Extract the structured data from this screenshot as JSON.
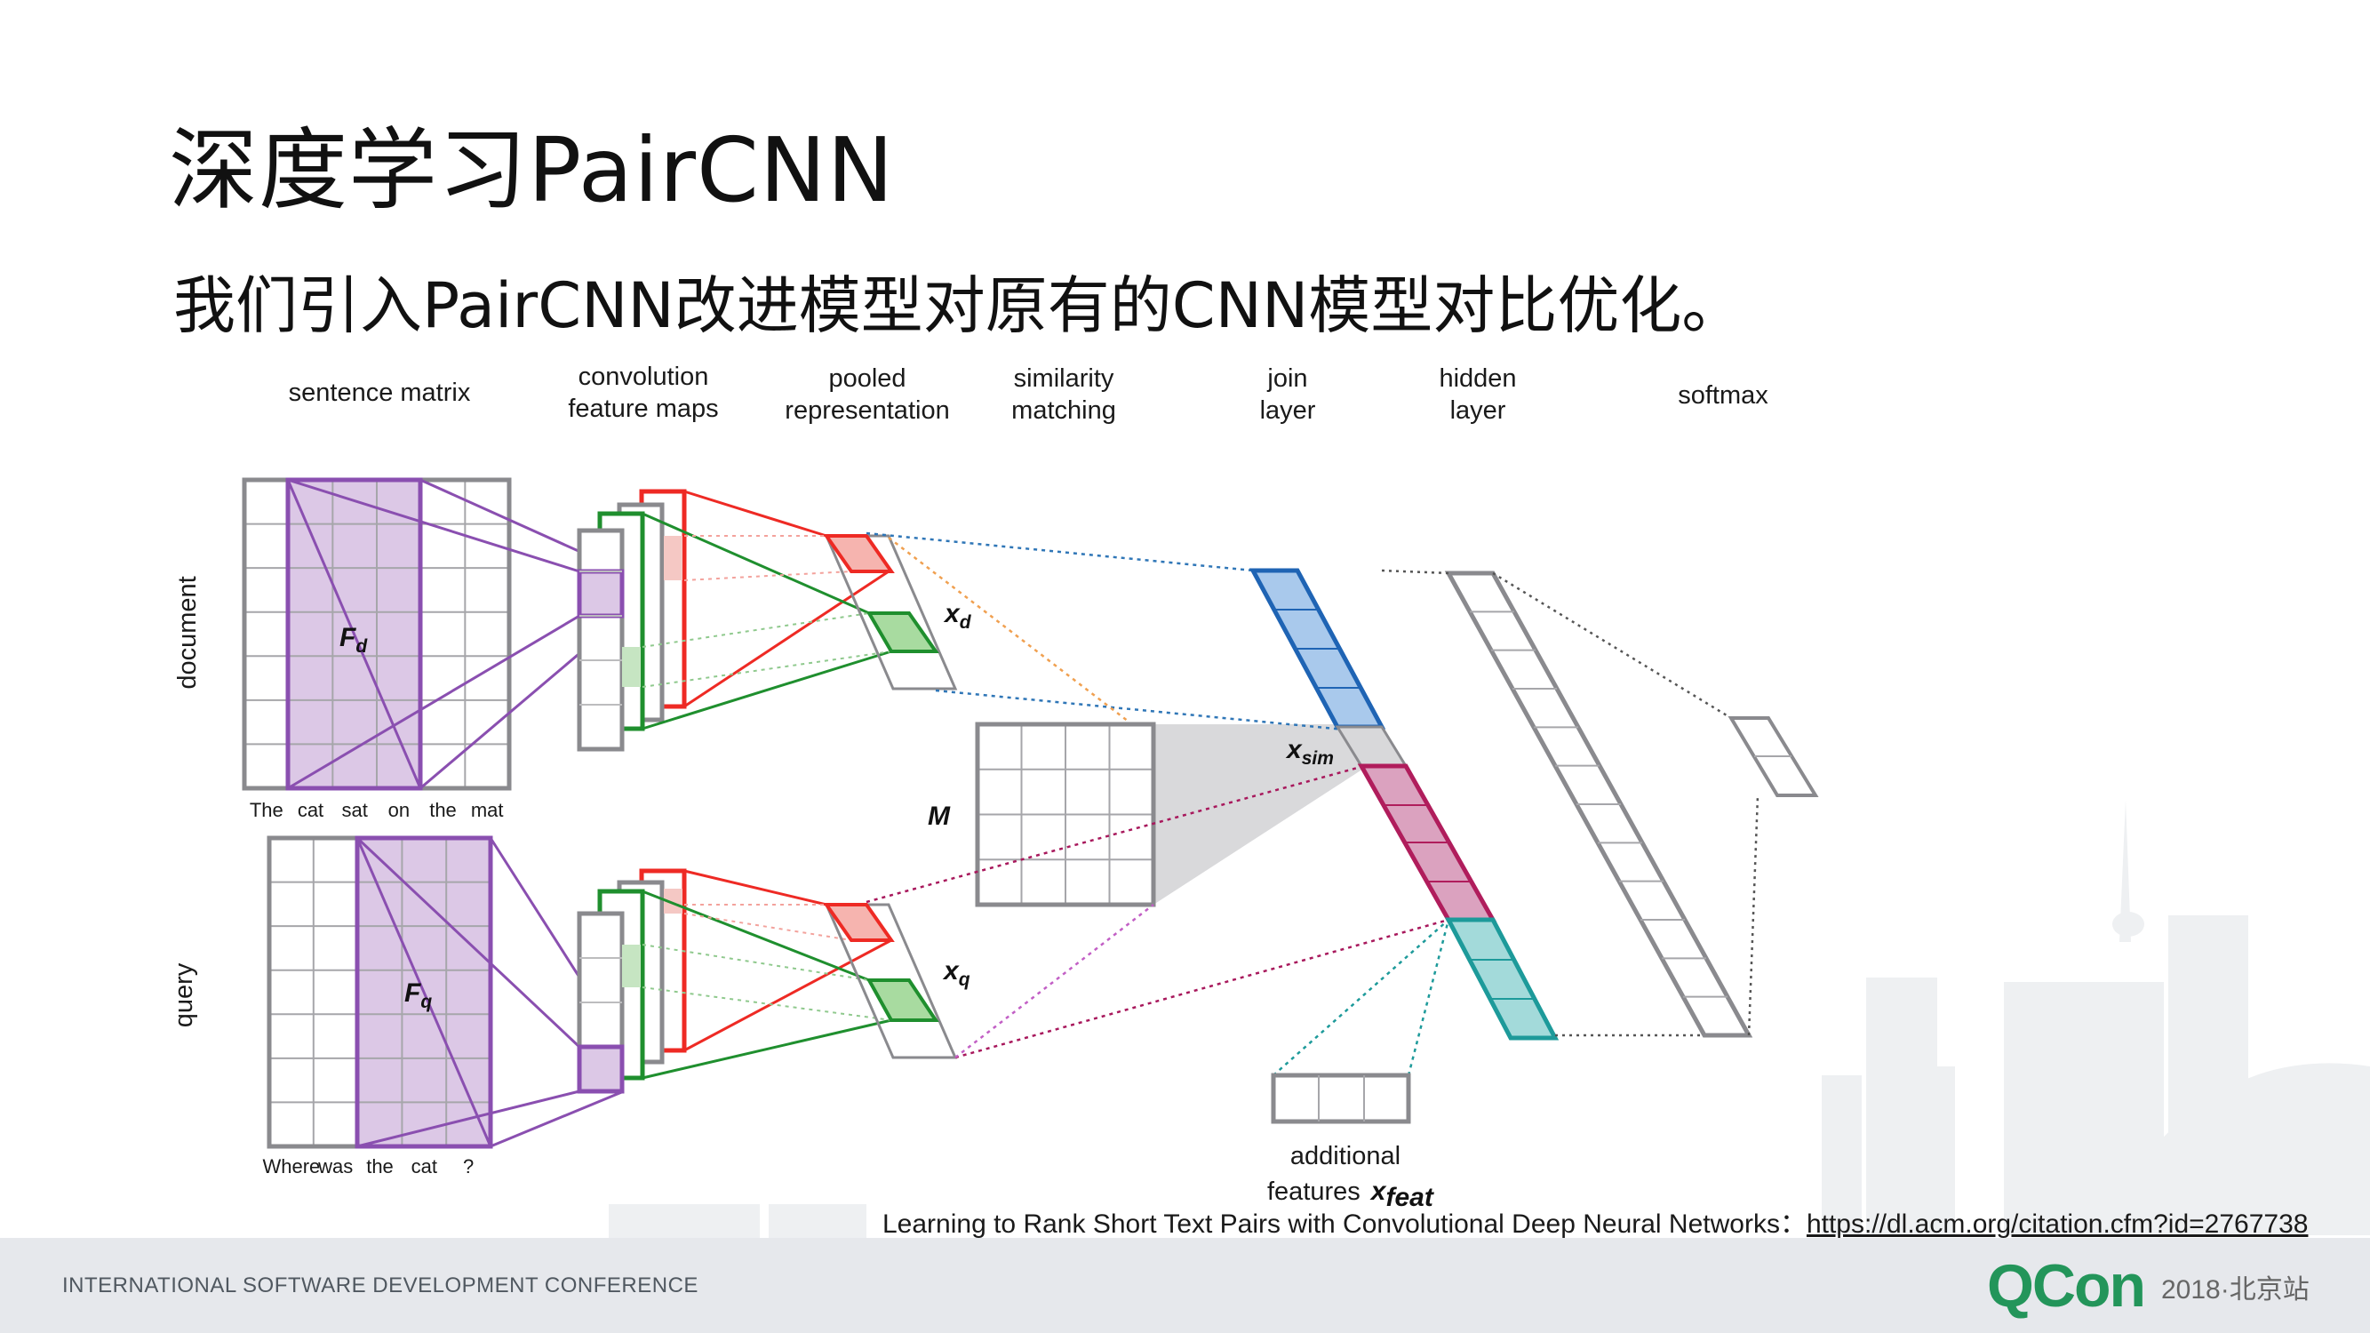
{
  "slide": {
    "title": "深度学习PairCNN",
    "subtitle": "我们引入PairCNN改进模型对原有的CNN模型对比优化。"
  },
  "diagram": {
    "stage_labels": {
      "sentence_matrix": "sentence matrix",
      "conv_1": "convolution",
      "conv_2": "feature maps",
      "pooled_1": "pooled",
      "pooled_2": "representation",
      "sim_1": "similarity",
      "sim_2": "matching",
      "join_1": "join",
      "join_2": "layer",
      "hidden_1": "hidden",
      "hidden_2": "layer",
      "softmax": "softmax"
    },
    "side_labels": {
      "document": "document",
      "query": "query"
    },
    "doc_words": [
      "The",
      "cat",
      "sat",
      "on",
      "the",
      "mat"
    ],
    "query_words": [
      "Where",
      "was",
      "the",
      "cat",
      "?"
    ],
    "symbols": {
      "fd_base": "F",
      "fd_sub": "d",
      "fq_base": "F",
      "fq_sub": "q",
      "xd_base": "x",
      "xd_sub": "d",
      "xq_base": "x",
      "xq_sub": "q",
      "m": "M",
      "xsim_base": "x",
      "xsim_sub": "sim",
      "xfeat_base": "x",
      "xfeat_sub": "feat"
    },
    "additional_1": "additional",
    "additional_2": "features",
    "colors": {
      "purple": "#8a4fb0",
      "purple_fill": "#dcc8e6",
      "red": "#ee2a24",
      "green": "#1f8f2e",
      "blue": "#1f64b4",
      "magenta": "#b01d5c",
      "teal": "#1d9a9a",
      "gray": "#8a8a8e"
    }
  },
  "citation": {
    "text": "Learning to Rank Short Text Pairs with Convolutional Deep Neural Networks：",
    "link": "https://dl.acm.org/citation.cfm?id=2767738"
  },
  "footer": {
    "conference": "INTERNATIONAL SOFTWARE DEVELOPMENT CONFERENCE",
    "brand": "QCon",
    "brand_sub": "2018·北京站"
  }
}
